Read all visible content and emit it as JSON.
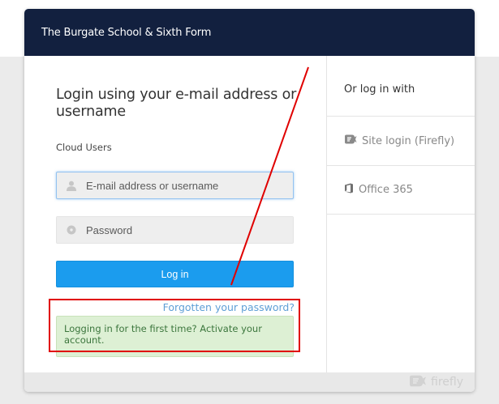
{
  "header": {
    "school_name": "The Burgate School & Sixth Form"
  },
  "login": {
    "title": "Login using your e-mail address or username",
    "cloud_users_label": "Cloud Users",
    "email": {
      "placeholder": "E-mail address or username",
      "value": "",
      "icon": "user-icon"
    },
    "password": {
      "placeholder": "Password",
      "value": "",
      "icon": "key-icon"
    },
    "button_label": "Log in",
    "forgot_link": "Forgotten your password?",
    "first_time_message": "Logging in for the first time? Activate your account."
  },
  "alt_login": {
    "heading": "Or log in with",
    "providers": [
      {
        "label": "Site login (Firefly)",
        "icon": "firefly-icon"
      },
      {
        "label": "Office 365",
        "icon": "office-365-icon"
      }
    ]
  },
  "footer": {
    "brand": "firefly",
    "icon": "firefly-logo-icon"
  },
  "annotations": {
    "color": "#e00000"
  },
  "colors": {
    "header_bg": "#12203f",
    "button_bg": "#1b9cee",
    "link": "#5f9fd6",
    "success_bg": "#ddf0d4",
    "success_text": "#3c763d"
  }
}
